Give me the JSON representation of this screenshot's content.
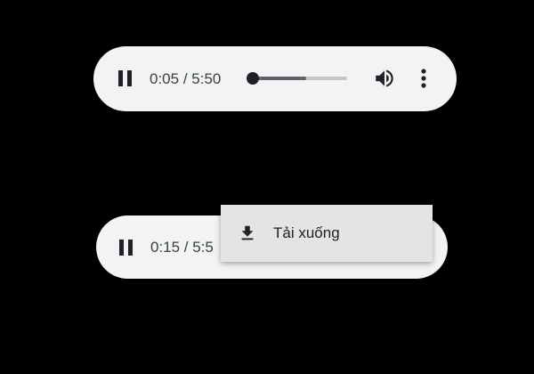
{
  "players": [
    {
      "state": "playing",
      "current_time": "0:05",
      "separator": " / ",
      "duration": "5:50",
      "progress_fraction": 0.014,
      "buffered_fraction": 0.57,
      "controls": {
        "pause_icon": "pause-icon",
        "volume_icon": "volume-icon",
        "more_icon": "more-vert-icon"
      }
    },
    {
      "state": "playing",
      "time_visible": "0:15 / 5:5",
      "controls": {
        "pause_icon": "pause-icon"
      }
    }
  ],
  "context_menu": {
    "items": [
      {
        "icon": "download-icon",
        "label": "Tải xuống"
      }
    ]
  },
  "colors": {
    "background": "#000000",
    "player_bg": "#f1f3f4",
    "menu_bg": "#e4e4e4",
    "icon": "#202124"
  }
}
